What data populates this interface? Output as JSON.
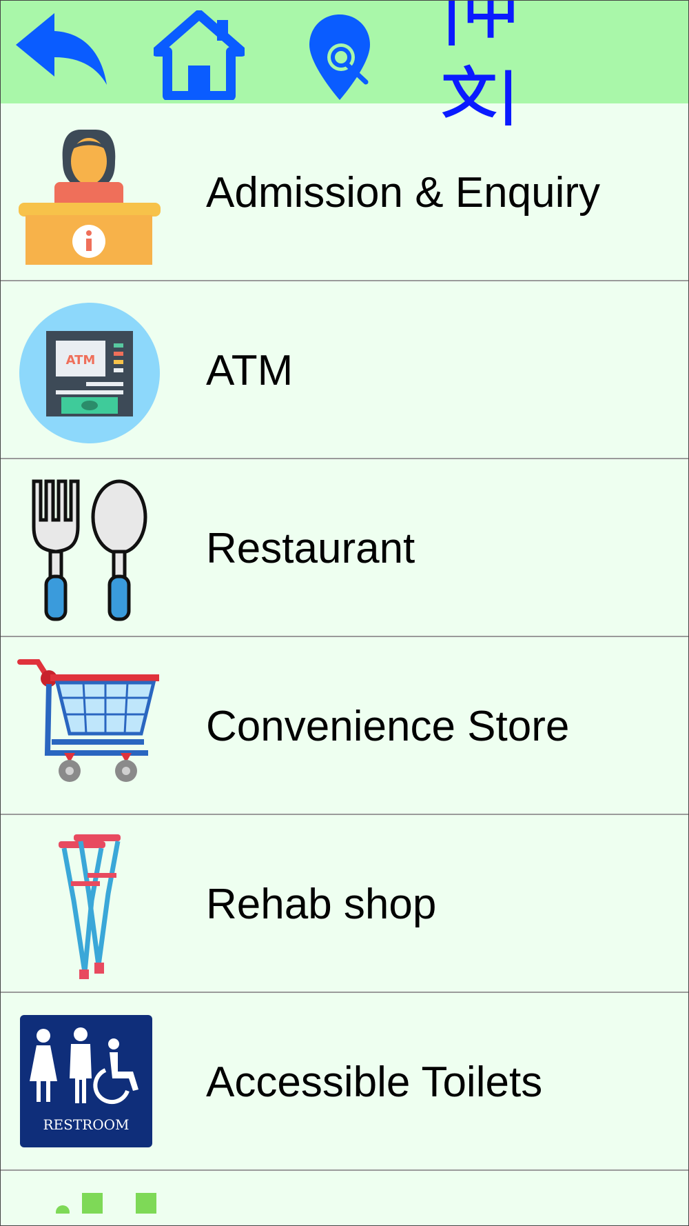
{
  "header": {
    "back_icon": "back-arrow-icon",
    "home_icon": "home-icon",
    "search_icon": "location-search-icon",
    "language_label": "|中文|",
    "accent_color": "#0a5cff",
    "bar_color": "#a9f7a9"
  },
  "list": {
    "items": [
      {
        "label": "Admission & Enquiry",
        "icon": "reception-desk-icon"
      },
      {
        "label": "ATM",
        "icon": "atm-icon",
        "icon_text": "ATM"
      },
      {
        "label": "Restaurant",
        "icon": "fork-spoon-icon"
      },
      {
        "label": "Convenience Store",
        "icon": "shopping-cart-icon"
      },
      {
        "label": "Rehab shop",
        "icon": "crutches-icon"
      },
      {
        "label": "Accessible Toilets",
        "icon": "restroom-sign-icon",
        "icon_text": "RESTROOM"
      }
    ]
  }
}
